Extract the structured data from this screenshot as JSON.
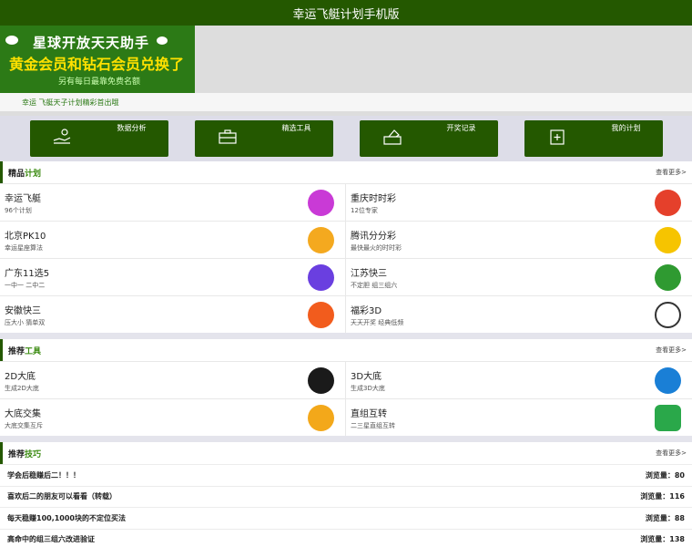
{
  "header": {
    "title": "幸运飞艇计划手机版"
  },
  "banner": {
    "line1": "星球开放天天助手",
    "line2": "黄金会员和钻石会员兑换了",
    "line3": "另有每日最靠免费名额"
  },
  "marquee": {
    "text": "幸运 飞艇天子计划精彩首出哦"
  },
  "categories": [
    {
      "label": "数据分析",
      "icon": "hand-coin-icon"
    },
    {
      "label": "精选工具",
      "icon": "toolbox-icon"
    },
    {
      "label": "开奖记录",
      "icon": "ballot-box-icon"
    },
    {
      "label": "我的计划",
      "icon": "add-plan-icon"
    }
  ],
  "plans_section": {
    "title_plain": "精品",
    "title_accent": "计划",
    "more": "查看更多>"
  },
  "plans": [
    {
      "name": "幸运飞艇",
      "sub": "96个计划",
      "logo_color": "#c93ad6"
    },
    {
      "name": "重庆时时彩",
      "sub": "12位专家",
      "logo_color": "#e5402b"
    },
    {
      "name": "北京PK10",
      "sub": "幸运星座算法",
      "logo_color": "#f4a91f"
    },
    {
      "name": "腾讯分分彩",
      "sub": "最快最火的时时彩",
      "logo_color": "#f6c400"
    },
    {
      "name": "广东11选5",
      "sub": "一中一 二中二",
      "logo_color": "#6a3fe0"
    },
    {
      "name": "江苏快三",
      "sub": "不定胆 组三组六",
      "logo_color": "#2f9a31"
    },
    {
      "name": "安徽快三",
      "sub": "压大小 猜单双",
      "logo_color": "#f25c1d"
    },
    {
      "name": "福彩3D",
      "sub": "天天开奖 经典低频",
      "logo_color": "#333333"
    }
  ],
  "tools_section": {
    "title_plain": "推荐",
    "title_accent": "工具",
    "more": "查看更多>"
  },
  "tools": [
    {
      "name": "2D大底",
      "sub": "生成2D大底",
      "logo_color": "#1a1a1a"
    },
    {
      "name": "3D大底",
      "sub": "生成3D大底",
      "logo_color": "#1a7fd6"
    },
    {
      "name": "大底交集",
      "sub": "大底交集互斥",
      "logo_color": "#f3a81a"
    },
    {
      "name": "直组互转",
      "sub": "二三星直组互转",
      "logo_color": "#2aa84a"
    }
  ],
  "tips_section": {
    "title_plain": "推荐",
    "title_accent": "技巧",
    "more": "查看更多>"
  },
  "tips": [
    {
      "title": "学会后稳赚后二！！！",
      "views": "浏览量：80"
    },
    {
      "title": "喜欢后二的朋友可以看看（转载）",
      "views": "浏览量：116"
    },
    {
      "title": "每天稳赚100,1000块的不定位买法",
      "views": "浏览量：88"
    },
    {
      "title": "高命中的组三组六改进验证",
      "views": "浏览量：138"
    }
  ]
}
